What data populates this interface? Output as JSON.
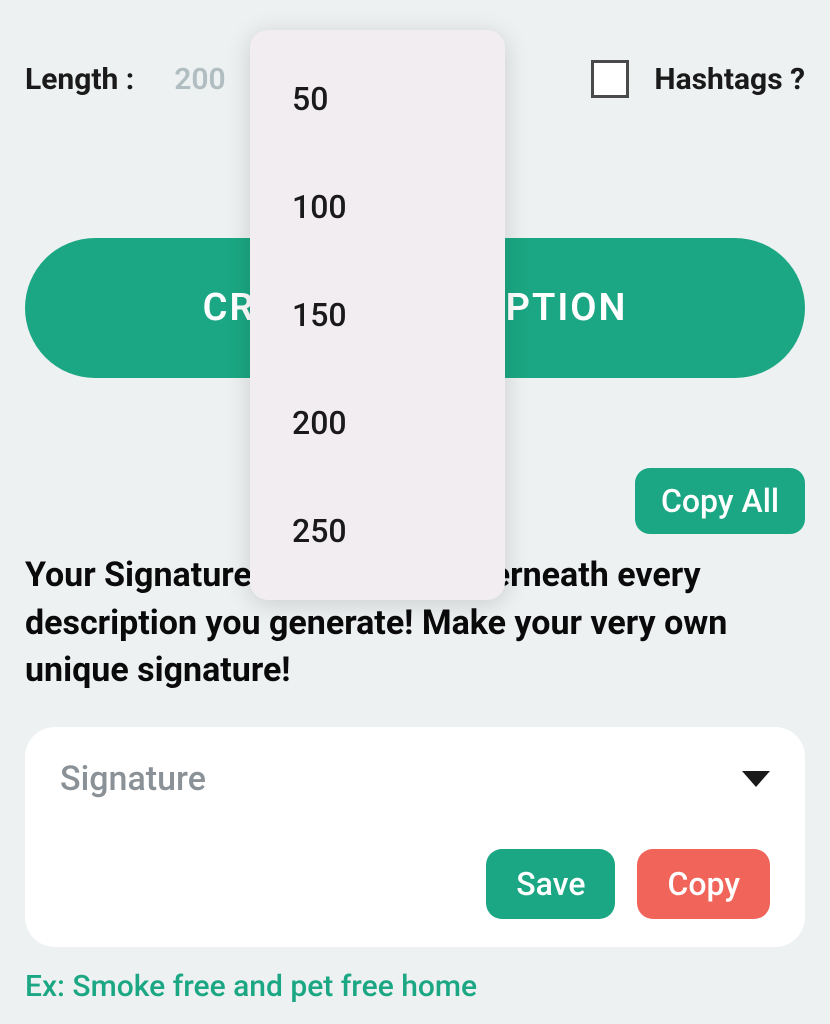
{
  "top": {
    "length_label": "Length :",
    "length_value": "200",
    "hashtags_label": "Hashtags ?"
  },
  "create_button": "CREATE DESCRIPTION",
  "copy_all": "Copy All",
  "signature_description": "Your Signature will appear underneath every description you generate! Make your very own unique signature!",
  "signature_card": {
    "label": "Signature",
    "save": "Save",
    "copy": "Copy"
  },
  "example": "Ex: Smoke free and pet free home",
  "dropdown": {
    "options": [
      "50",
      "100",
      "150",
      "200",
      "250"
    ]
  }
}
